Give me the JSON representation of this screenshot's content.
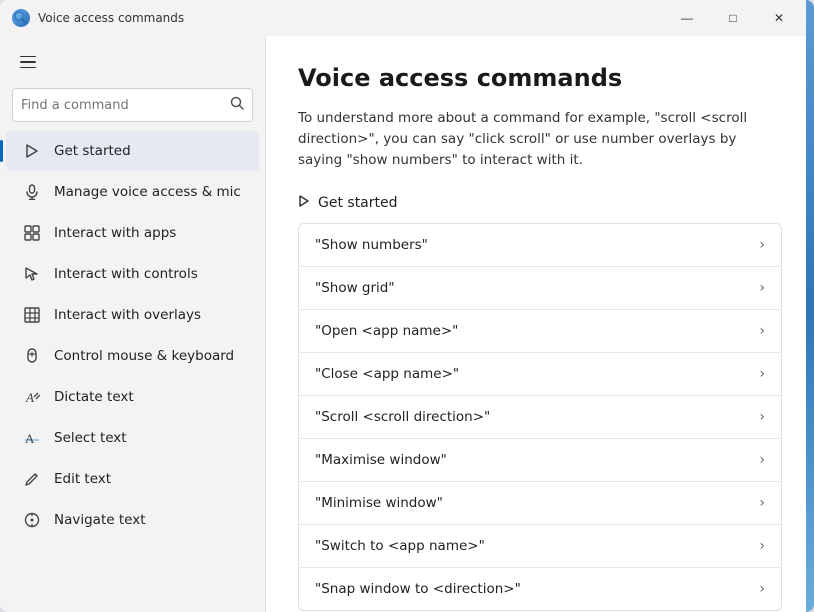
{
  "window": {
    "title": "Voice access commands",
    "titlebar_icon": "🎤",
    "controls": {
      "minimize": "—",
      "maximize": "□",
      "close": "✕"
    }
  },
  "sidebar": {
    "search_placeholder": "Find a command",
    "nav_items": [
      {
        "id": "get-started",
        "label": "Get started",
        "icon": "triangle",
        "active": true
      },
      {
        "id": "manage-voice",
        "label": "Manage voice access & mic",
        "icon": "mic",
        "active": false
      },
      {
        "id": "interact-apps",
        "label": "Interact with apps",
        "icon": "grid",
        "active": false
      },
      {
        "id": "interact-controls",
        "label": "Interact with controls",
        "icon": "cursor",
        "active": false
      },
      {
        "id": "interact-overlays",
        "label": "Interact with overlays",
        "icon": "grid-overlay",
        "active": false
      },
      {
        "id": "control-mouse",
        "label": "Control mouse & keyboard",
        "icon": "mouse",
        "active": false
      },
      {
        "id": "dictate-text",
        "label": "Dictate text",
        "icon": "dictate",
        "active": false
      },
      {
        "id": "select-text",
        "label": "Select text",
        "icon": "select-text",
        "active": false
      },
      {
        "id": "edit-text",
        "label": "Edit text",
        "icon": "edit",
        "active": false
      },
      {
        "id": "navigate-text",
        "label": "Navigate text",
        "icon": "navigate",
        "active": false
      }
    ]
  },
  "content": {
    "title": "Voice access commands",
    "description": "To understand more about a command for example, \"scroll <scroll direction>\", you can say \"click scroll\" or use number overlays by saying \"show numbers\" to interact with it.",
    "section_label": "Get started",
    "commands": [
      {
        "label": "\"Show numbers\""
      },
      {
        "label": "\"Show grid\""
      },
      {
        "label": "\"Open <app name>\""
      },
      {
        "label": "\"Close <app name>\""
      },
      {
        "label": "\"Scroll <scroll direction>\""
      },
      {
        "label": "\"Maximise window\""
      },
      {
        "label": "\"Minimise window\""
      },
      {
        "label": "\"Switch to <app name>\""
      },
      {
        "label": "\"Snap window to <direction>\""
      }
    ]
  }
}
